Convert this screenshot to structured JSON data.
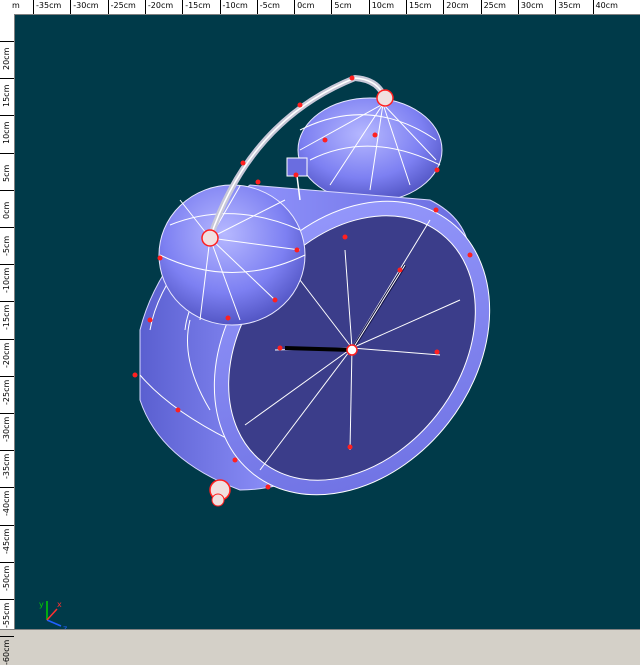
{
  "ruler_top": {
    "unit_start": "m",
    "labels": [
      "-35cm",
      "-30cm",
      "-25cm",
      "-20cm",
      "-15cm",
      "-10cm",
      "-5cm",
      "0cm",
      "5cm",
      "10cm",
      "15cm",
      "20cm",
      "25cm",
      "30cm",
      "35cm",
      "40cm"
    ]
  },
  "ruler_left": {
    "labels": [
      "20cm",
      "15cm",
      "10cm",
      "5cm",
      "0cm",
      "-5cm",
      "-10cm",
      "-15cm",
      "-20cm",
      "-25cm",
      "-30cm",
      "-35cm",
      "-40cm",
      "-45cm",
      "-50cm",
      "-55cm",
      "-60cm"
    ]
  },
  "viewport": {
    "background": "#003a49",
    "model": "alarm-clock",
    "body_color": "#7b7ef0",
    "face_color": "#3b3d8a",
    "wire_color": "#ffffff",
    "handle_color": "#ff2020"
  },
  "axes_gizmo": {
    "x": "x",
    "y": "y",
    "z": "z"
  }
}
